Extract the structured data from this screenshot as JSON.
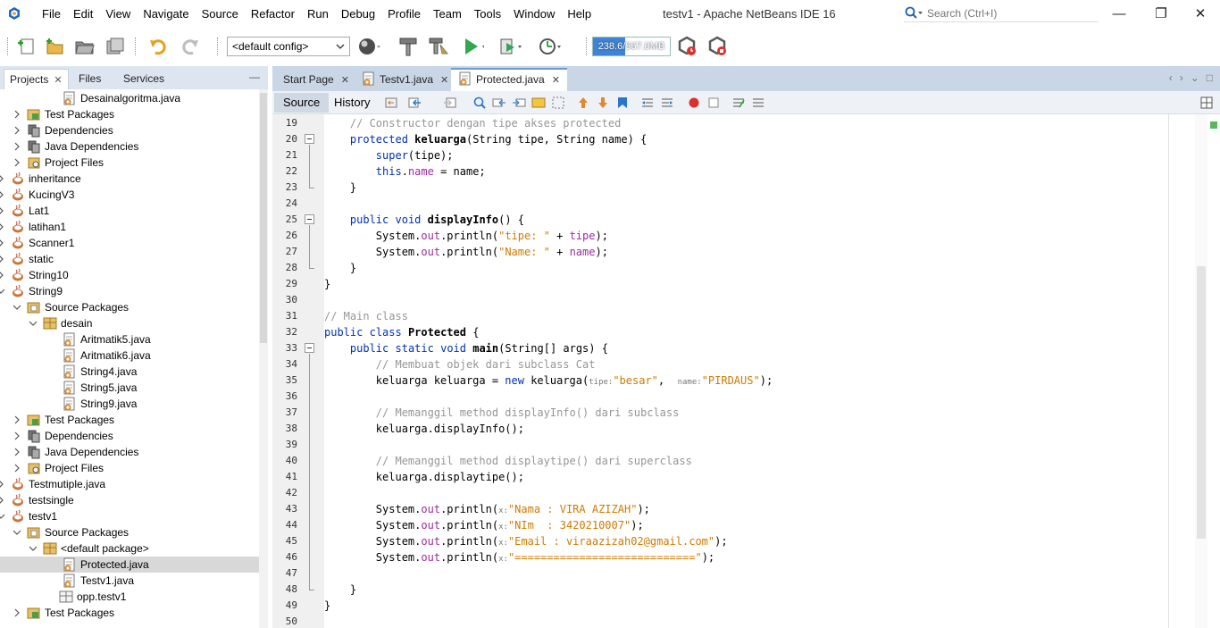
{
  "window": {
    "title": "testv1 - Apache NetBeans IDE 16",
    "menu": [
      "File",
      "Edit",
      "View",
      "Navigate",
      "Source",
      "Refactor",
      "Run",
      "Debug",
      "Profile",
      "Team",
      "Tools",
      "Window",
      "Help"
    ],
    "search_placeholder": "Search (Ctrl+I)"
  },
  "toolbar": {
    "config": "<default config>",
    "memory_text": "238.6/567.0MB",
    "memory_fraction": 0.42
  },
  "left_panel": {
    "tabs": [
      {
        "label": "Projects",
        "active": true,
        "closable": true
      },
      {
        "label": "Files",
        "active": false,
        "closable": false
      },
      {
        "label": "Services",
        "active": false,
        "closable": false
      }
    ],
    "tree": [
      {
        "label": "Desainalgoritma.java",
        "depth": 4,
        "icon": "java-file-icon",
        "arrow": "none"
      },
      {
        "label": "Test Packages",
        "depth": 1,
        "icon": "test-packages-icon",
        "arrow": "right"
      },
      {
        "label": "Dependencies",
        "depth": 1,
        "icon": "dependencies-icon",
        "arrow": "right"
      },
      {
        "label": "Java Dependencies",
        "depth": 1,
        "icon": "java-dependencies-icon",
        "arrow": "right"
      },
      {
        "label": "Project Files",
        "depth": 1,
        "icon": "project-files-icon",
        "arrow": "right"
      },
      {
        "label": "inheritance",
        "depth": 0,
        "icon": "project-icon",
        "arrow": "right"
      },
      {
        "label": "KucingV3",
        "depth": 0,
        "icon": "project-icon",
        "arrow": "right"
      },
      {
        "label": "Lat1",
        "depth": 0,
        "icon": "project-icon",
        "arrow": "right"
      },
      {
        "label": "latihan1",
        "depth": 0,
        "icon": "project-icon",
        "arrow": "right"
      },
      {
        "label": "Scanner1",
        "depth": 0,
        "icon": "project-icon",
        "arrow": "right"
      },
      {
        "label": "static",
        "depth": 0,
        "icon": "project-icon",
        "arrow": "right"
      },
      {
        "label": "String10",
        "depth": 0,
        "icon": "project-icon",
        "arrow": "right"
      },
      {
        "label": "String9",
        "depth": 0,
        "icon": "project-icon",
        "arrow": "down"
      },
      {
        "label": "Source Packages",
        "depth": 1,
        "icon": "source-packages-icon",
        "arrow": "down"
      },
      {
        "label": "desain",
        "depth": 2,
        "icon": "package-icon",
        "arrow": "down"
      },
      {
        "label": "Aritmatik5.java",
        "depth": 4,
        "icon": "java-file-icon",
        "arrow": "none"
      },
      {
        "label": "Aritmatik6.java",
        "depth": 4,
        "icon": "java-file-icon",
        "arrow": "none"
      },
      {
        "label": "String4.java",
        "depth": 4,
        "icon": "java-file-icon",
        "arrow": "none"
      },
      {
        "label": "String5.java",
        "depth": 4,
        "icon": "java-file-icon",
        "arrow": "none"
      },
      {
        "label": "String9.java",
        "depth": 4,
        "icon": "java-file-icon",
        "arrow": "none"
      },
      {
        "label": "Test Packages",
        "depth": 1,
        "icon": "test-packages-icon",
        "arrow": "right"
      },
      {
        "label": "Dependencies",
        "depth": 1,
        "icon": "dependencies-icon",
        "arrow": "right"
      },
      {
        "label": "Java Dependencies",
        "depth": 1,
        "icon": "java-dependencies-icon",
        "arrow": "right"
      },
      {
        "label": "Project Files",
        "depth": 1,
        "icon": "project-files-icon",
        "arrow": "right"
      },
      {
        "label": "Testmutiple.java",
        "depth": 0,
        "icon": "project-icon",
        "arrow": "right"
      },
      {
        "label": "testsingle",
        "depth": 0,
        "icon": "project-icon",
        "arrow": "right"
      },
      {
        "label": "testv1",
        "depth": 0,
        "icon": "project-icon",
        "arrow": "down"
      },
      {
        "label": "Source Packages",
        "depth": 1,
        "icon": "source-packages-icon",
        "arrow": "down"
      },
      {
        "label": "<default package>",
        "depth": 2,
        "icon": "package-icon",
        "arrow": "down"
      },
      {
        "label": "Protected.java",
        "depth": 4,
        "icon": "java-file-icon",
        "arrow": "none",
        "selected": true
      },
      {
        "label": "Testv1.java",
        "depth": 4,
        "icon": "java-file-icon",
        "arrow": "none"
      },
      {
        "label": "opp.testv1",
        "depth": 3,
        "icon": "empty-package-icon",
        "arrow": "none"
      },
      {
        "label": "Test Packages",
        "depth": 1,
        "icon": "test-packages-icon",
        "arrow": "right"
      }
    ]
  },
  "editor": {
    "tabs": [
      {
        "label": "Start Page",
        "active": false,
        "closable": true,
        "icon": false
      },
      {
        "label": "Testv1.java",
        "active": false,
        "closable": true,
        "icon": true
      },
      {
        "label": "Protected.java",
        "active": true,
        "closable": true,
        "icon": true
      }
    ],
    "source_tab": "Source",
    "history_tab": "History",
    "lines": [
      {
        "n": "19",
        "t": [
          [
            "c",
            "    // Constructor dengan tipe akses protected"
          ]
        ]
      },
      {
        "n": "20",
        "fold": "start",
        "t": [
          [
            "",
            "    "
          ],
          [
            "k",
            "protected"
          ],
          [
            "",
            " "
          ],
          [
            "b",
            "keluarga"
          ],
          [
            "",
            "(String tipe, String name) {"
          ]
        ]
      },
      {
        "n": "21",
        "t": [
          [
            "",
            "        "
          ],
          [
            "k",
            "super"
          ],
          [
            "",
            "(tipe);"
          ]
        ]
      },
      {
        "n": "22",
        "t": [
          [
            "",
            "        "
          ],
          [
            "k",
            "this"
          ],
          [
            "",
            "."
          ],
          [
            "f",
            "name"
          ],
          [
            "",
            " = name;"
          ]
        ]
      },
      {
        "n": "23",
        "fold": "end",
        "t": [
          [
            "",
            "    }"
          ]
        ]
      },
      {
        "n": "24",
        "t": []
      },
      {
        "n": "25",
        "fold": "start",
        "t": [
          [
            "",
            "    "
          ],
          [
            "k",
            "public"
          ],
          [
            "",
            " "
          ],
          [
            "k",
            "void"
          ],
          [
            "",
            " "
          ],
          [
            "b",
            "displayInfo"
          ],
          [
            "",
            "() {"
          ]
        ]
      },
      {
        "n": "26",
        "t": [
          [
            "",
            "        System."
          ],
          [
            "f",
            "out"
          ],
          [
            "",
            ".println("
          ],
          [
            "s",
            "\"tipe: \""
          ],
          [
            "",
            " + "
          ],
          [
            "f",
            "tipe"
          ],
          [
            "",
            ");"
          ]
        ]
      },
      {
        "n": "27",
        "t": [
          [
            "",
            "        System."
          ],
          [
            "f",
            "out"
          ],
          [
            "",
            ".println("
          ],
          [
            "s",
            "\"Name: \""
          ],
          [
            "",
            " + "
          ],
          [
            "f",
            "name"
          ],
          [
            "",
            ");"
          ]
        ]
      },
      {
        "n": "28",
        "fold": "end",
        "t": [
          [
            "",
            "    }"
          ]
        ]
      },
      {
        "n": "29",
        "t": [
          [
            "",
            "}"
          ]
        ]
      },
      {
        "n": "30",
        "t": []
      },
      {
        "n": "31",
        "t": [
          [
            "c",
            "// Main class"
          ]
        ]
      },
      {
        "n": "32",
        "t": [
          [
            "k",
            "public"
          ],
          [
            "",
            " "
          ],
          [
            "k",
            "class"
          ],
          [
            "",
            " "
          ],
          [
            "b",
            "Protected"
          ],
          [
            "",
            " {"
          ]
        ]
      },
      {
        "n": "33",
        "fold": "start",
        "t": [
          [
            "",
            "    "
          ],
          [
            "k",
            "public"
          ],
          [
            "",
            " "
          ],
          [
            "k",
            "static"
          ],
          [
            "",
            " "
          ],
          [
            "k",
            "void"
          ],
          [
            "",
            " "
          ],
          [
            "b",
            "main"
          ],
          [
            "",
            "(String[] args) {"
          ]
        ]
      },
      {
        "n": "34",
        "t": [
          [
            "c",
            "        // Membuat objek dari subclass Cat"
          ]
        ]
      },
      {
        "n": "35",
        "t": [
          [
            "",
            "        keluarga keluarga = "
          ],
          [
            "k",
            "new"
          ],
          [
            "",
            " keluarga("
          ],
          [
            "h",
            "tipe:"
          ],
          [
            "s",
            "\"besar\""
          ],
          [
            "",
            ",  "
          ],
          [
            "h",
            "name:"
          ],
          [
            "s",
            "\"PIRDAUS\""
          ],
          [
            "",
            ");"
          ]
        ]
      },
      {
        "n": "36",
        "t": []
      },
      {
        "n": "37",
        "t": [
          [
            "c",
            "        // Memanggil method displayInfo() dari subclass"
          ]
        ]
      },
      {
        "n": "38",
        "t": [
          [
            "",
            "        keluarga.displayInfo();"
          ]
        ]
      },
      {
        "n": "39",
        "t": []
      },
      {
        "n": "40",
        "t": [
          [
            "c",
            "        // Memanggil method displaytipe() dari superclass"
          ]
        ]
      },
      {
        "n": "41",
        "t": [
          [
            "",
            "        keluarga.displaytipe();"
          ]
        ]
      },
      {
        "n": "42",
        "t": []
      },
      {
        "n": "43",
        "t": [
          [
            "",
            "        System."
          ],
          [
            "f",
            "out"
          ],
          [
            "",
            ".println("
          ],
          [
            "h",
            "x:"
          ],
          [
            "s",
            "\"Nama : VIRA AZIZAH\""
          ],
          [
            "",
            ");"
          ]
        ]
      },
      {
        "n": "44",
        "t": [
          [
            "",
            "        System."
          ],
          [
            "f",
            "out"
          ],
          [
            "",
            ".println("
          ],
          [
            "h",
            "x:"
          ],
          [
            "s",
            "\"NIm  : 3420210007\""
          ],
          [
            "",
            ");"
          ]
        ]
      },
      {
        "n": "45",
        "t": [
          [
            "",
            "        System."
          ],
          [
            "f",
            "out"
          ],
          [
            "",
            ".println("
          ],
          [
            "h",
            "x:"
          ],
          [
            "s",
            "\"Email : viraazizah02@gmail.com\""
          ],
          [
            "",
            ");"
          ]
        ]
      },
      {
        "n": "46",
        "t": [
          [
            "",
            "        System."
          ],
          [
            "f",
            "out"
          ],
          [
            "",
            ".println("
          ],
          [
            "h",
            "x:"
          ],
          [
            "s",
            "\"============================\""
          ],
          [
            "",
            ");"
          ]
        ]
      },
      {
        "n": "47",
        "t": []
      },
      {
        "n": "48",
        "fold": "end",
        "t": [
          [
            "",
            "    }"
          ]
        ]
      },
      {
        "n": "49",
        "t": [
          [
            "",
            "}"
          ]
        ]
      },
      {
        "n": "50",
        "t": []
      }
    ]
  }
}
